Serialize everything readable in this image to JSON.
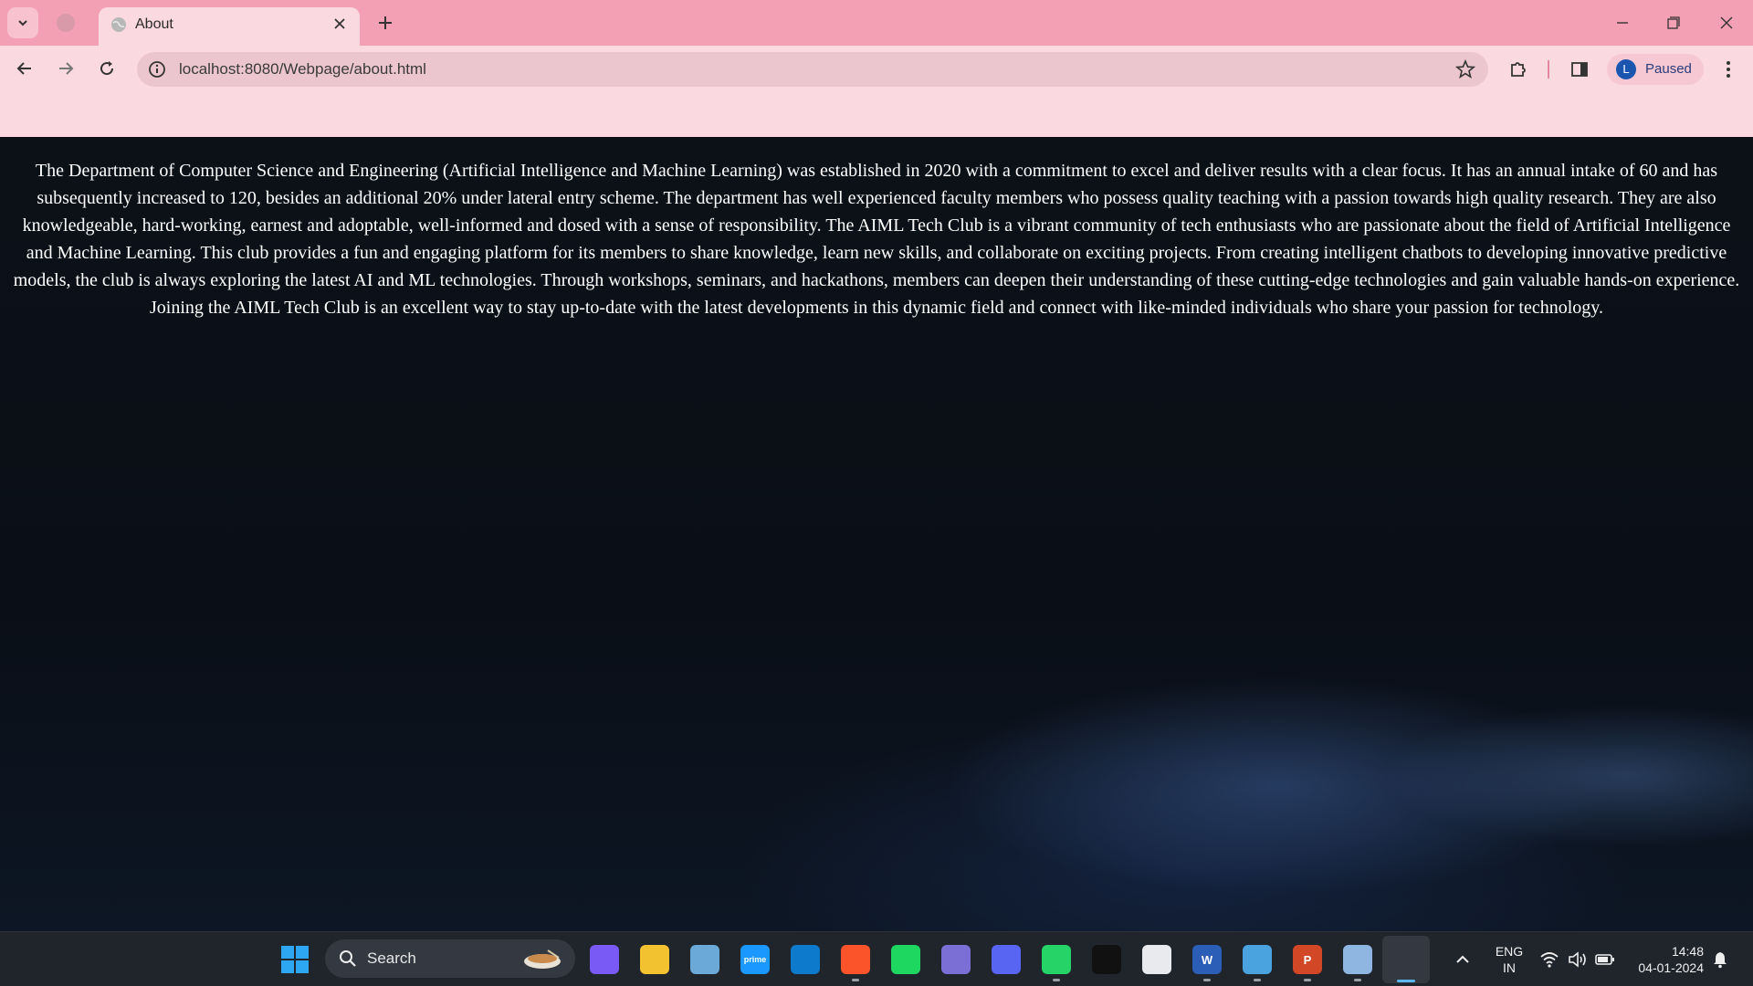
{
  "browser": {
    "tab_title": "About",
    "url": "localhost:8080/Webpage/about.html",
    "profile_initial": "L",
    "profile_status": "Paused"
  },
  "page": {
    "about_text": "The Department of Computer Science and Engineering (Artificial Intelligence and Machine Learning) was established in 2020 with a commitment to excel and deliver results with a clear focus. It has an annual intake of 60 and has subsequently increased to 120, besides an additional 20% under lateral entry scheme. The department has well experienced faculty members who possess quality teaching with a passion towards high quality research. They are also knowledgeable, hard-working, earnest and adoptable, well-informed and dosed with a sense of responsibility. The AIML Tech Club is a vibrant community of tech enthusiasts who are passionate about the field of Artificial Intelligence and Machine Learning. This club provides a fun and engaging platform for its members to share knowledge, learn new skills, and collaborate on exciting projects. From creating intelligent chatbots to developing innovative predictive models, the club is always exploring the latest AI and ML technologies. Through workshops, seminars, and hackathons, members can deepen their understanding of these cutting-edge technologies and gain valuable hands-on experience. Joining the AIML Tech Club is an excellent way to stay up-to-date with the latest developments in this dynamic field and connect with like-minded individuals who share your passion for technology."
  },
  "taskbar": {
    "search_label": "Search",
    "lang_line1": "ENG",
    "lang_line2": "IN",
    "time": "14:48",
    "date": "04-01-2024",
    "apps": [
      {
        "name": "copilot-icon",
        "glyph": "",
        "color": "#7a5af5"
      },
      {
        "name": "file-explorer-icon",
        "glyph": "",
        "color": "#f2c231"
      },
      {
        "name": "photos-icon",
        "glyph": "",
        "color": "#6aa9d8"
      },
      {
        "name": "prime-video-icon",
        "glyph": "prime",
        "color": "#1a98ff"
      },
      {
        "name": "vscode-icon",
        "glyph": "",
        "color": "#0e7acc"
      },
      {
        "name": "brave-icon",
        "glyph": "",
        "color": "#fb542b"
      },
      {
        "name": "spotify-icon",
        "glyph": "",
        "color": "#1ed760"
      },
      {
        "name": "app-icon",
        "glyph": "",
        "color": "#7b6fd6"
      },
      {
        "name": "discord-icon",
        "glyph": "",
        "color": "#5865f2"
      },
      {
        "name": "whatsapp-icon",
        "glyph": "",
        "color": "#25d366"
      },
      {
        "name": "capcut-icon",
        "glyph": "",
        "color": "#111111"
      },
      {
        "name": "messenger-icon",
        "glyph": "",
        "color": "#e8eaed"
      },
      {
        "name": "word-icon",
        "glyph": "W",
        "color": "#2b5eb7"
      },
      {
        "name": "notepad-icon",
        "glyph": "",
        "color": "#4aa3df"
      },
      {
        "name": "powerpoint-icon",
        "glyph": "P",
        "color": "#d24726"
      },
      {
        "name": "virtualbox-icon",
        "glyph": "",
        "color": "#8fb6e0"
      },
      {
        "name": "chrome-icon",
        "glyph": "",
        "color": "#e8453c"
      }
    ]
  }
}
